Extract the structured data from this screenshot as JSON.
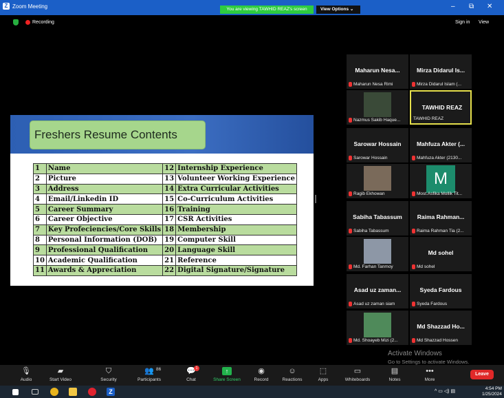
{
  "window": {
    "title": "Zoom Meeting",
    "minimize": "–",
    "restore": "⧉",
    "close": "✕"
  },
  "banner": {
    "sharing_text": "You are viewing TAWHID REAZ's screen",
    "view_options": "View Options  ⌄"
  },
  "subbar": {
    "recording": "Recording",
    "sign_in": "Sign in",
    "view": "View"
  },
  "slide": {
    "title": "Freshers Resume Contents",
    "rows": [
      {
        "n1": "1",
        "a": "Name",
        "n2": "12",
        "b": "Internship Experience"
      },
      {
        "n1": "2",
        "a": "Picture",
        "n2": "13",
        "b": "Volunteer Working Experience"
      },
      {
        "n1": "3",
        "a": "Address",
        "n2": "14",
        "b": "Extra Curricular Activities"
      },
      {
        "n1": "4",
        "a": "Email/Linkedin ID",
        "n2": "15",
        "b": "Co-Curriculum Activities"
      },
      {
        "n1": "5",
        "a": "Career Summary",
        "n2": "16",
        "b": "Training"
      },
      {
        "n1": "6",
        "a": "Career Objective",
        "n2": "17",
        "b": "CSR Activities"
      },
      {
        "n1": "7",
        "a": "Key Profeciencies/Core Skills",
        "n2": "18",
        "b": "Membership"
      },
      {
        "n1": "8",
        "a": "Personal Information (DOB)",
        "n2": "19",
        "b": "Computer Skill"
      },
      {
        "n1": "9",
        "a": "Professional Qualification",
        "n2": "20",
        "b": "Language Skill"
      },
      {
        "n1": "10",
        "a": "Academic Qualification",
        "n2": "21",
        "b": "Reference"
      },
      {
        "n1": "11",
        "a": "Awards & Appreciation",
        "n2": "22",
        "b": "Digital Signature/Signature"
      }
    ]
  },
  "participants": [
    {
      "name": "Maharun Nesa...",
      "sub": "Maharun Nesa Rimi"
    },
    {
      "name": "Mirza Didarul Is...",
      "sub": "Mirza Didarul Islam (..."
    },
    {
      "name": "",
      "sub": "Nazmus Sakib Haque..."
    },
    {
      "name": "TAWHID REAZ",
      "sub": "TAWHID REAZ"
    },
    {
      "name": "Sarowar Hossain",
      "sub": "Sarowar Hossain"
    },
    {
      "name": "Mahfuza Akter (...",
      "sub": "Mahfuza Akter (2130..."
    },
    {
      "name": "",
      "sub": "Ragib Ekhowan"
    },
    {
      "name": "M",
      "sub": "Most.Asfika Mollik Tit..."
    },
    {
      "name": "Sabiha Tabassum",
      "sub": "Sabiha Tabassum"
    },
    {
      "name": "Raima Rahman...",
      "sub": "Raima Rahman Tia (2..."
    },
    {
      "name": "",
      "sub": "Md. Farhan Tanmoy"
    },
    {
      "name": "Md sohel",
      "sub": "Md sohel"
    },
    {
      "name": "Asad uz zaman...",
      "sub": "Asad uz zaman siam"
    },
    {
      "name": "Syeda Fardous",
      "sub": "Syeda Fardous"
    },
    {
      "name": "",
      "sub": "Md. Shoayeb Mizi (2..."
    },
    {
      "name": "Md Shazzad Ho...",
      "sub": "Md Shazzad Hossen"
    }
  ],
  "watermark": {
    "line1": "Activate Windows",
    "line2": "Go to Settings to activate Windows."
  },
  "toolbar": {
    "audio": "Audio",
    "video": "Start Video",
    "security": "Security",
    "participants": "Participants",
    "participants_count": "86",
    "chat": "Chat",
    "share": "Share Screen",
    "record": "Record",
    "reactions": "Reactions",
    "apps": "Apps",
    "whiteboards": "Whiteboards",
    "notes": "Notes",
    "more": "More",
    "leave": "Leave",
    "chat_badge": "1"
  },
  "taskbar": {
    "time": "4:54 PM",
    "date": "1/25/2024"
  }
}
